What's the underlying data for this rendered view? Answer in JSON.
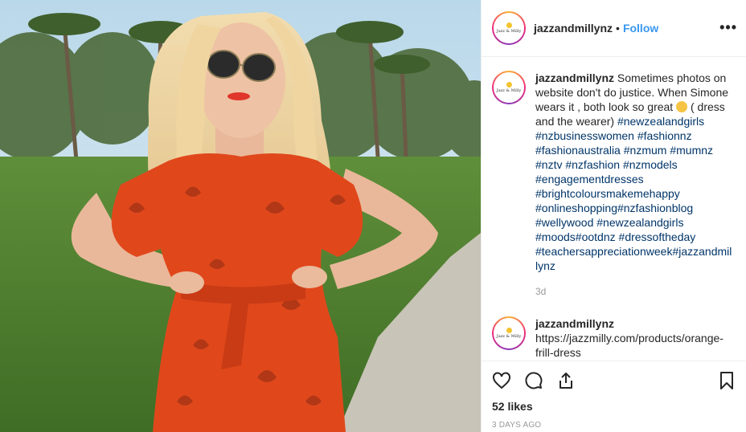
{
  "post": {
    "username": "jazzandmillynz",
    "follow_label": "Follow",
    "separator": "•",
    "more_label": "•••",
    "avatar_text": "Jazz & Milly"
  },
  "caption": {
    "username": "jazzandmillynz",
    "text_before": "Sometimes photos on website don't do justice. When Simone wears it , both look so great ",
    "text_after": " ( dress and the wearer)",
    "hashtags": [
      "#newzealandgirls",
      "#nzbusinesswomen",
      "#fashionnz",
      "#fashionaustralia",
      "#nzmum",
      "#mumnz",
      "#nztv",
      "#nzfashion",
      "#nzmodels",
      "#engagementdresses",
      "#brightcoloursmakemehappy",
      "#onlineshopping#nzfashionblog",
      "#wellywood",
      "#newzealandgirls",
      "#moods#ootdnz",
      "#dressoftheday",
      "#teachersappreciationweek#jazzandmillynz"
    ],
    "time": "3d",
    "emoji": "grinning-face-emoji"
  },
  "reply": {
    "username": "jazzandmillynz",
    "text": "https://jazzmilly.com/products/orange-frill-dress"
  },
  "actions": {
    "likes": "52 likes",
    "posted": "3 DAYS AGO"
  },
  "colors": {
    "link_blue": "#3897f0",
    "hashtag": "#003569",
    "dress_orange": "#e0481c"
  }
}
